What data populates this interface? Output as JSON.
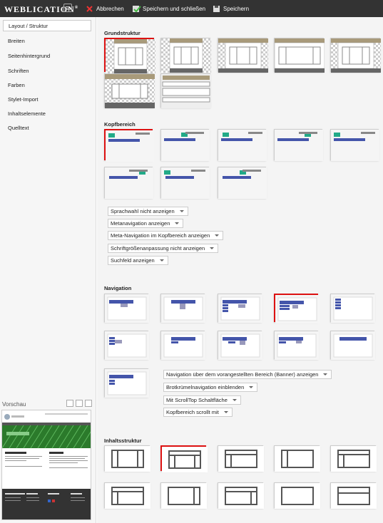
{
  "app": {
    "brand": "WEBLICATION",
    "brand_mark": "®"
  },
  "toolbar": {
    "cancel_label": "Abbrechen",
    "save_close_label": "Speichern und schließen",
    "save_label": "Speichern"
  },
  "sidebar": {
    "items": [
      {
        "label": "Layout / Struktur",
        "active": true
      },
      {
        "label": "Breiten"
      },
      {
        "label": "Seitenhintergrund"
      },
      {
        "label": "Schriften"
      },
      {
        "label": "Farben"
      },
      {
        "label": "Stylet-Import"
      },
      {
        "label": "Inhaltselemente"
      },
      {
        "label": "Quelltext"
      }
    ],
    "preview_label": "Vorschau"
  },
  "sections": {
    "grundstruktur": {
      "title": "Grundstruktur",
      "selected_index": 0,
      "count": 7
    },
    "kopfbereich": {
      "title": "Kopfbereich",
      "selected_index": 0,
      "count": 10,
      "dropdowns": [
        "Sprachwahl nicht anzeigen",
        "Metanavigation anzeigen",
        "Meta-Navigation im Kopfbereich anzeigen",
        "Schriftgrößenanpassung nicht anzeigen",
        "Suchfeld anzeigen"
      ]
    },
    "navigation": {
      "title": "Navigation",
      "selected_index": 3,
      "count": 11,
      "dropdowns": [
        "Navigation über dem vorangestellten Bereich (Banner) anzeigen",
        "Brotkrümelnavigation einblenden",
        "Mit ScrollTop Schaltfläche",
        "Kopfbereich scrollt mit"
      ]
    },
    "inhaltsstruktur": {
      "title": "Inhaltsstruktur",
      "selected_index": 1,
      "count": 10
    }
  },
  "colors": {
    "topbar": "#333333",
    "selection": "#dd1111",
    "nav_blue": "#4455aa",
    "accent_teal": "#22aa88",
    "header_tan": "#a89a7a"
  }
}
